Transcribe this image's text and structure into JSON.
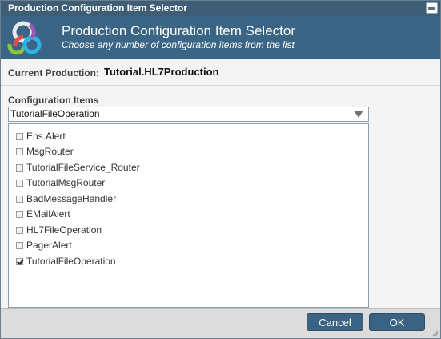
{
  "window": {
    "title": "Production Configuration Item Selector"
  },
  "header": {
    "title": "Production Configuration Item Selector",
    "subtitle": "Choose any number of configuration items from the list"
  },
  "production": {
    "label": "Current Production:",
    "value": "Tutorial.HL7Production"
  },
  "config_items": {
    "label": "Configuration Items",
    "selected": "TutorialFileOperation",
    "items": [
      {
        "label": "Ens.Alert",
        "checked": false
      },
      {
        "label": "MsgRouter",
        "checked": false
      },
      {
        "label": "TutorialFileService_Router",
        "checked": false
      },
      {
        "label": "TutorialMsgRouter",
        "checked": false
      },
      {
        "label": "BadMessageHandler",
        "checked": false
      },
      {
        "label": "EMailAlert",
        "checked": false
      },
      {
        "label": "HL7FileOperation",
        "checked": false
      },
      {
        "label": "PagerAlert",
        "checked": false
      },
      {
        "label": "TutorialFileOperation",
        "checked": true
      }
    ]
  },
  "buttons": {
    "cancel": "Cancel",
    "ok": "OK"
  },
  "colors": {
    "titlebar": "#3d5e75",
    "header": "#3b6584",
    "button": "#3a6282"
  }
}
